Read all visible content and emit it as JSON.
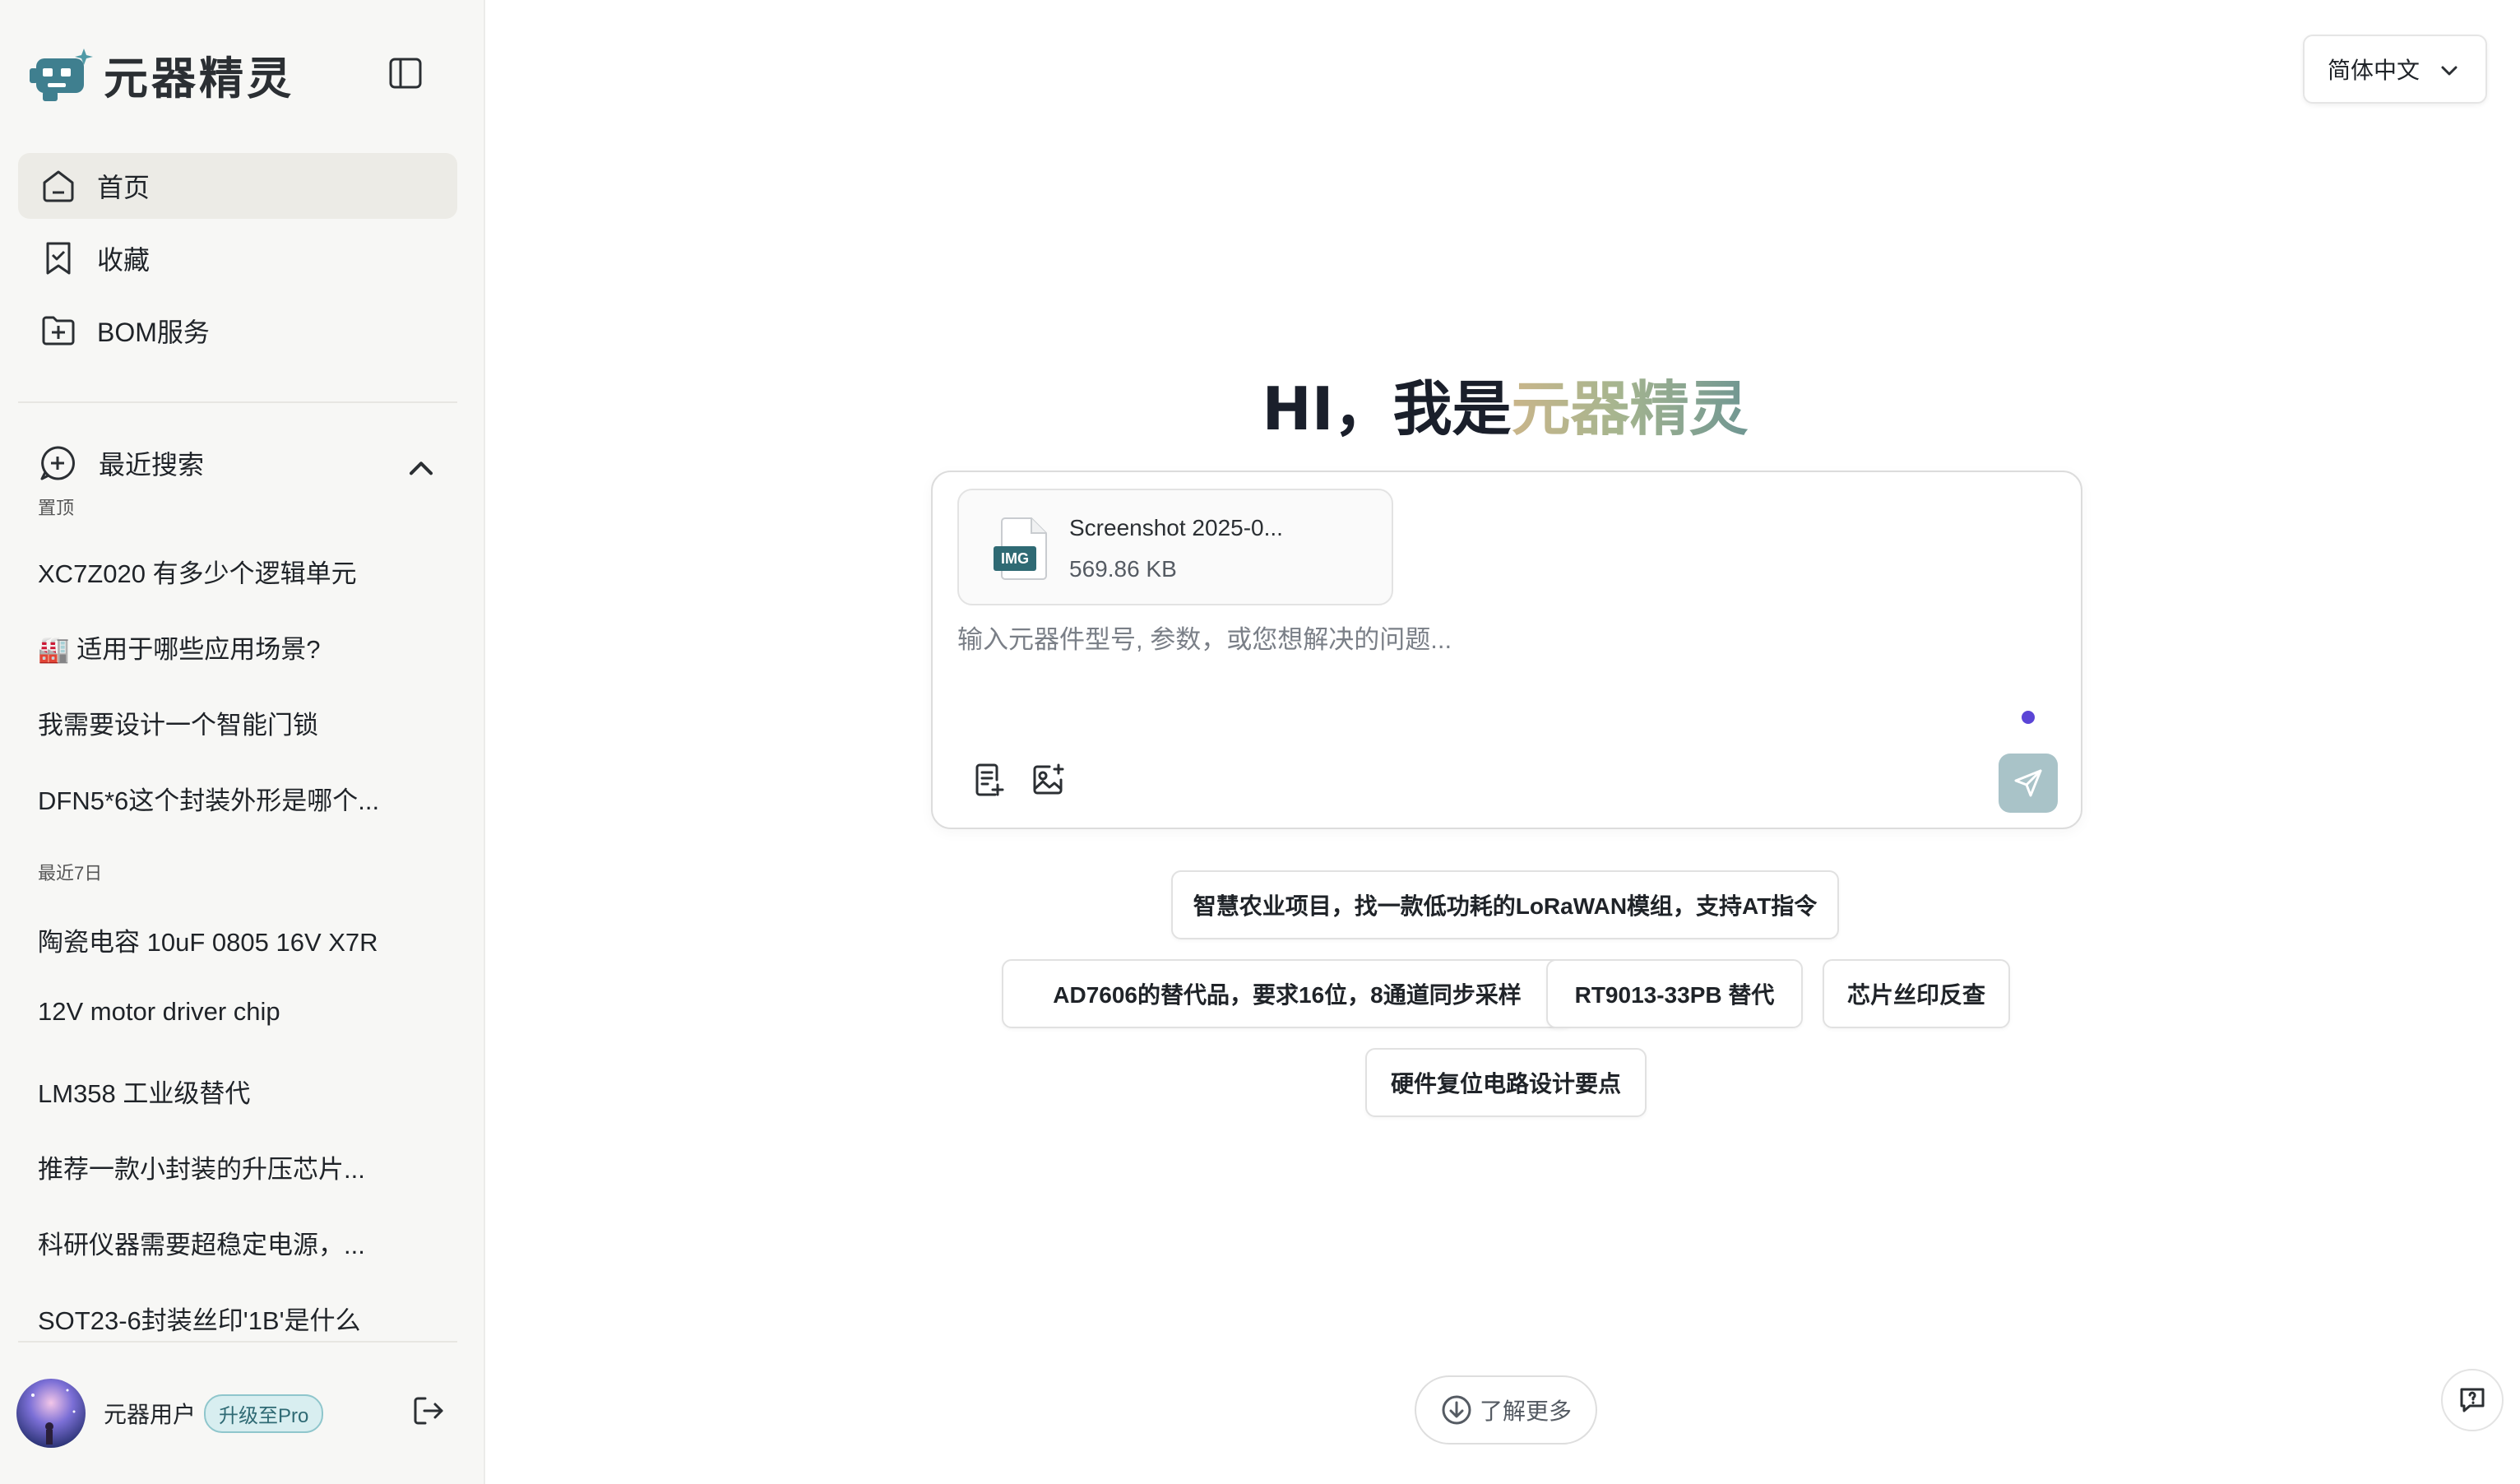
{
  "app": {
    "logo_text": "元器精灵"
  },
  "sidebar": {
    "nav": [
      {
        "label": "首页",
        "icon": "home-icon",
        "active": true
      },
      {
        "label": "收藏",
        "icon": "bookmark-icon",
        "active": false
      },
      {
        "label": "BOM服务",
        "icon": "folder-plus-icon",
        "active": false
      }
    ],
    "recent_search_title": "最近搜索",
    "pinned_label": "置顶",
    "pinned": [
      "XC7Z020 有多少个逻辑单元",
      "🏭 适用于哪些应用场景?",
      "我需要设计一个智能门锁",
      "DFN5*6这个封装外形是哪个..."
    ],
    "last7_label": "最近7日",
    "last7": [
      "陶瓷电容 10uF 0805 16V X7R",
      "12V motor driver chip",
      "LM358 工业级替代",
      "推荐一款小封装的升压芯片...",
      "科研仪器需要超稳定电源，...",
      "SOT23-6封装丝印'1B'是什么"
    ],
    "user": {
      "name": "元器用户",
      "badge": "升级至Pro"
    }
  },
  "header": {
    "language": "简体中文"
  },
  "hero": {
    "greeting": "HI，我是",
    "brand": "元器精灵"
  },
  "composer": {
    "attachment": {
      "type_label": "IMG",
      "name": "Screenshot 2025-0...",
      "size": "569.86 KB"
    },
    "placeholder": "输入元器件型号, 参数，或您想解决的问题..."
  },
  "suggestions": [
    "智慧农业项目，找一款低功耗的LoRaWAN模组，支持AT指令",
    "AD7606的替代品，要求16位，8通道同步采样",
    "RT9013-33PB 替代",
    "芯片丝印反查",
    "硬件复位电路设计要点"
  ],
  "footer": {
    "learn_more": "了解更多"
  },
  "colors": {
    "accent_send": "#a9c3c8",
    "brand_gradient_start": "#c9b58a",
    "brand_gradient_end": "#6f9692",
    "status_dot": "#5b45d6",
    "sidebar_bg": "#f7f7f5"
  }
}
